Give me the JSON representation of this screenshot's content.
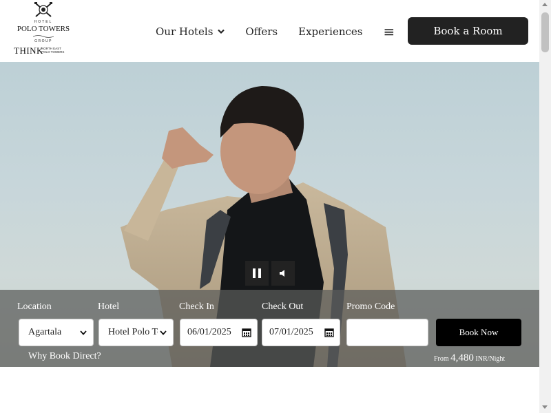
{
  "header": {
    "logo": {
      "hotel_text": "HOTEL",
      "brand_text": "POLO TOWERS",
      "group_text": "GROUP",
      "think_text": "THINK",
      "ne_line1": "NORTH EAST",
      "ne_line2": "POLO TOWERS"
    },
    "nav": {
      "our_hotels": "Our Hotels",
      "offers": "Offers",
      "experiences": "Experiences",
      "menu_icon": "≡"
    },
    "book_room_label": "Book a Room"
  },
  "hero": {
    "controls": {
      "pause_icon": "pause-icon",
      "mute_icon": "volume-icon"
    }
  },
  "booking": {
    "location_label": "Location",
    "location_value": "Agartala",
    "hotel_label": "Hotel",
    "hotel_value": "Hotel Polo Towers",
    "checkin_label": "Check In",
    "checkin_value": "06/01/2025",
    "checkout_label": "Check Out",
    "checkout_value": "07/01/2025",
    "promo_label": "Promo Code",
    "promo_value": "",
    "book_now_label": "Book Now",
    "why_direct": "Why Book Direct?",
    "from_prefix": "From",
    "from_amount": "4,480",
    "from_suffix": "INR/Night"
  },
  "colors": {
    "primary_button": "#222222",
    "book_now_button": "#000000",
    "booking_bar": "#5a5c5a"
  }
}
